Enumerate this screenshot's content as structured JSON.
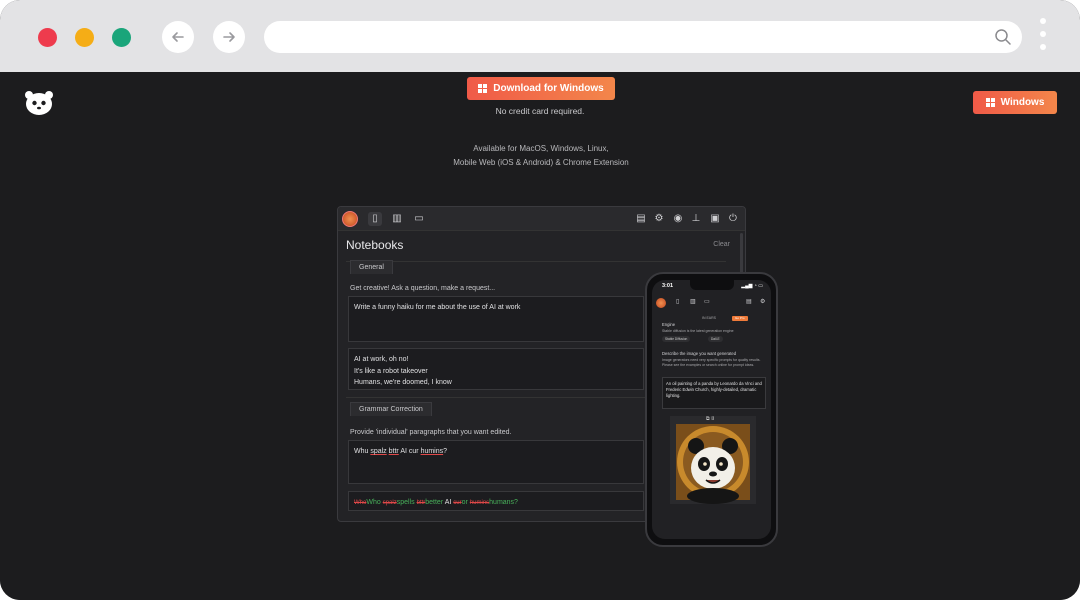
{
  "browser": {
    "controls": [
      "close",
      "minimize",
      "maximize"
    ],
    "back_icon": "arrow-left-icon",
    "forward_icon": "arrow-right-icon",
    "url": "",
    "search_icon": "search-icon",
    "menu_icon": "kebab-menu-icon"
  },
  "site": {
    "logo_icon": "panda-logo-icon",
    "header_button": "Windows",
    "download_button": "Download for Windows",
    "no_credit_card": "No credit card required.",
    "availability_line1": "Available for MacOS, Windows, Linux,",
    "availability_line2": "Mobile Web (iOS & Android) & Chrome Extension",
    "accent_color": "#f05a48"
  },
  "desktop_app": {
    "title": "Notebooks",
    "clear": "Clear",
    "notebooks": [
      {
        "tab": "General",
        "instruction": "Get creative! Ask a question, make a request...",
        "prompt": "Write a funny haiku for me about the use of AI at work",
        "response_lines": [
          "AI at work, oh no!",
          "It's like a robot takeover",
          "Humans, we're doomed, I know"
        ]
      },
      {
        "tab": "Grammar Correction",
        "instruction": "Provide 'individual' paragraphs that you want edited.",
        "prompt_parts": [
          "Whu ",
          "spalz",
          " ",
          "bttr",
          " AI cur ",
          "humins",
          "?"
        ],
        "correction": {
          "del1": "Who",
          "ins1": "Who",
          "del2": "spalz",
          "ins2": "spells",
          "del3": "bttr",
          "ins3": "better",
          "plain": " AI ",
          "del4": "cur",
          "ins4": "or",
          "del5": "humins",
          "ins5": "humans?"
        }
      }
    ]
  },
  "mobile_app": {
    "time": "3:01",
    "status": "▂▄▆ ◔ ▭",
    "tab_label": "IN EARS",
    "badge": "Go Pro",
    "engine_label": "Engine",
    "engine_desc": "Stable diffusion is the latest generation engine",
    "engine_options": [
      "Stable Diffusion",
      "Dall-E"
    ],
    "describe_label": "Describe the image you want generated",
    "describe_desc": "Image generators need very specific prompts for quality results. Please see the examples or search online for prompt ideas.",
    "prompt": "An oil painting of a panda by Leonardo da Vinci and Frederic Edwin Church, highly-detailed, dramatic lighting."
  }
}
